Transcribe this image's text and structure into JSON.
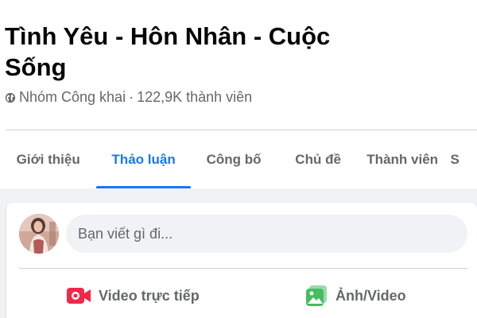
{
  "group": {
    "title": "Tình Yêu - Hôn Nhân - Cuộc Sống",
    "privacy": "Nhóm Công khai",
    "separator": "·",
    "members": "122,9K thành viên",
    "privacy_icon": "globe-icon"
  },
  "tabs": [
    {
      "label": "Giới thiệu",
      "active": false
    },
    {
      "label": "Thảo luận",
      "active": true
    },
    {
      "label": "Công bố",
      "active": false
    },
    {
      "label": "Chủ đề",
      "active": false
    },
    {
      "label": "Thành viên",
      "active": false
    },
    {
      "label": "S",
      "active": false
    }
  ],
  "composer": {
    "placeholder": "Bạn viết gì đi...",
    "actions": [
      {
        "label": "Video trực tiếp",
        "icon": "live-video-icon"
      },
      {
        "label": "Ảnh/Video",
        "icon": "photo-video-icon"
      }
    ]
  },
  "colors": {
    "accent": "#1877f2",
    "secondary_text": "#65676b",
    "live_red": "#f02849",
    "photo_green": "#45bd62",
    "background": "#f0f2f5"
  }
}
